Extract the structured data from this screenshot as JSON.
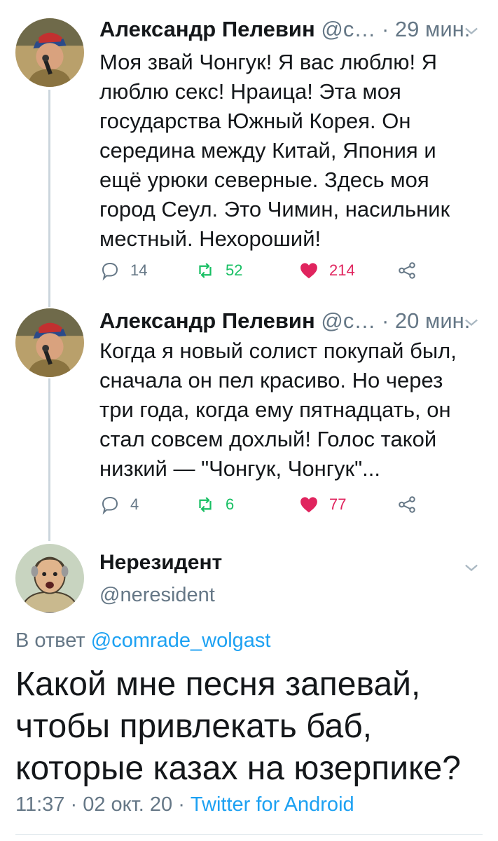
{
  "colors": {
    "accent": "#1da1f2",
    "muted": "#657786",
    "text": "#14171a",
    "retweet": "#17bf63",
    "like": "#e0245e",
    "thread_line": "#ccd6dd"
  },
  "tweets": [
    {
      "name": "Александр Пелевин",
      "handle": "@с…",
      "sep": "·",
      "time": "29 мин.",
      "lines": [
        "Моя звай Чонгук! Я вас люблю! Я",
        "люблю секс! Нраица! Эта моя",
        "государства Южный Корея. Он",
        "середина между Китай, Япония и",
        "ещё урюки северные. Здесь моя",
        "город Сеул. Это Чимин, насильник",
        "местный. Нехороший!"
      ],
      "replies": "14",
      "retweets": "52",
      "likes": "214"
    },
    {
      "name": "Александр Пелевин",
      "handle": "@с…",
      "sep": "·",
      "time": "20 мин.",
      "lines": [
        "Когда я новый солист покупай был,",
        "сначала он пел красиво. Но через",
        "три года, когда ему пятнадцать, он",
        "стал совсем дохлый! Голос такой",
        "низкий — \"Чонгук, Чонгук\"..."
      ],
      "replies": "4",
      "retweets": "6",
      "likes": "77"
    }
  ],
  "main": {
    "name": "Нерезидент",
    "handle": "@neresident",
    "reply_prefix": "В ответ",
    "reply_to": "@comrade_wolgast",
    "lines": [
      "Какой мне песня запевай,",
      "чтобы привлекать баб,",
      "которые казах на юзерпике?"
    ],
    "time": "11:37",
    "sep": "·",
    "date": "02 окт. 20",
    "client": "Twitter for Android"
  },
  "icons": {
    "reply": "reply-icon",
    "retweet": "retweet-icon",
    "like": "heart-icon",
    "share": "share-icon",
    "caret": "chevron-down-icon"
  }
}
